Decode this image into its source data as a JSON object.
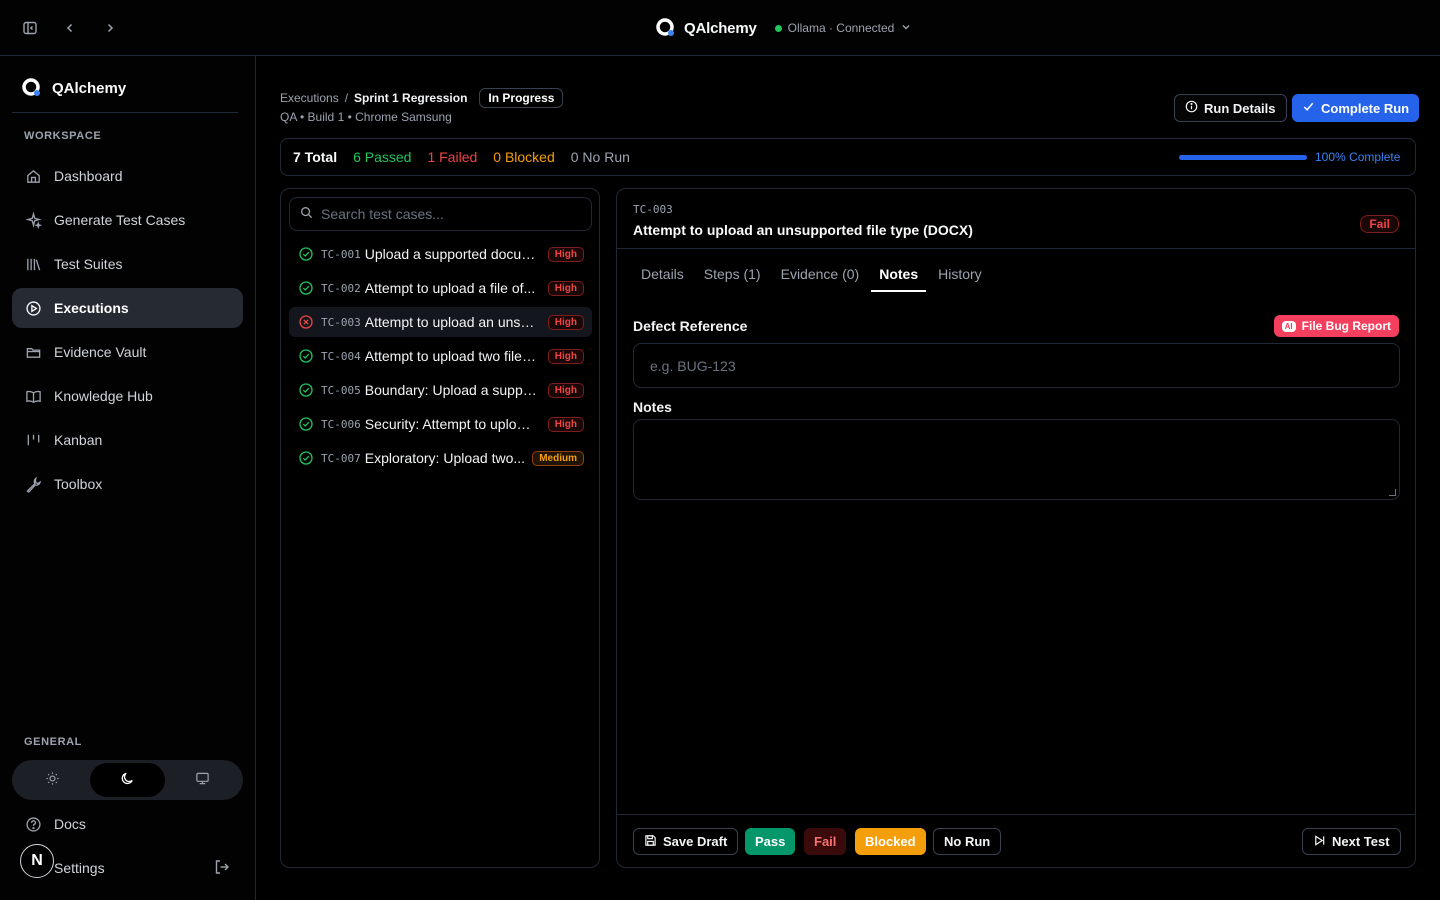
{
  "titlebar": {
    "brand": "QAlchemy",
    "status": "Ollama · Connected",
    "icons": [
      "sidebar-toggle-icon",
      "back-icon",
      "forward-icon",
      "chevron-down-icon"
    ]
  },
  "sidebar": {
    "brand": "QAlchemy",
    "workspace_label": "WORKSPACE",
    "general_label": "GENERAL",
    "items": [
      {
        "label": "Dashboard",
        "icon": "home-icon"
      },
      {
        "label": "Generate Test Cases",
        "icon": "sparkles-icon"
      },
      {
        "label": "Test Suites",
        "icon": "library-icon"
      },
      {
        "label": "Executions",
        "icon": "play-circle-icon",
        "active": true
      },
      {
        "label": "Evidence Vault",
        "icon": "folder-icon"
      },
      {
        "label": "Knowledge Hub",
        "icon": "book-icon"
      },
      {
        "label": "Kanban",
        "icon": "kanban-icon"
      },
      {
        "label": "Toolbox",
        "icon": "wrench-icon"
      }
    ],
    "theme_options": [
      "light",
      "dark",
      "system"
    ],
    "theme_selected": "dark",
    "general_items": [
      {
        "label": "Docs",
        "icon": "help-circle-icon"
      },
      {
        "label": "Settings",
        "icon": "settings-icon"
      }
    ],
    "avatar_letter": "N"
  },
  "header": {
    "breadcrumb_root": "Executions",
    "breadcrumb_sep": "/",
    "breadcrumb_current": "Sprint 1 Regression",
    "status_pill": "In Progress",
    "subline": "QA • Build 1 • Chrome Samsung",
    "run_details_label": "Run Details",
    "complete_run_label": "Complete Run"
  },
  "stats": {
    "total": "7 Total",
    "passed": "6 Passed",
    "failed": "1 Failed",
    "blocked": "0 Blocked",
    "no_run": "0 No Run",
    "progress_fraction": 1.0,
    "progress_label": "100% Complete"
  },
  "test_list": {
    "search_placeholder": "Search test cases...",
    "items": [
      {
        "id": "TC-001",
        "title": "Upload a supported document...",
        "priority": "High",
        "status": "passed"
      },
      {
        "id": "TC-002",
        "title": "Attempt to upload a file of...",
        "priority": "High",
        "status": "passed"
      },
      {
        "id": "TC-003",
        "title": "Attempt to upload an unsupported...",
        "priority": "High",
        "status": "failed",
        "selected": true
      },
      {
        "id": "TC-004",
        "title": "Attempt to upload two files...",
        "priority": "High",
        "status": "passed"
      },
      {
        "id": "TC-005",
        "title": "Boundary: Upload a supported...",
        "priority": "High",
        "status": "passed"
      },
      {
        "id": "TC-006",
        "title": "Security: Attempt to upload...",
        "priority": "High",
        "status": "passed"
      },
      {
        "id": "TC-007",
        "title": "Exploratory: Upload two...",
        "priority": "Medium",
        "status": "passed"
      }
    ]
  },
  "detail": {
    "id": "TC-003",
    "title": "Attempt to upload an unsupported file type (DOCX)",
    "result_badge": "Fail",
    "tabs": [
      "Details",
      "Steps (1)",
      "Evidence (0)",
      "Notes",
      "History"
    ],
    "active_tab": "Notes",
    "defect_label": "Defect Reference",
    "file_bug_label": "File Bug Report",
    "ai_badge": "AI",
    "defect_placeholder": "e.g. BUG-123",
    "notes_label": "Notes",
    "notes_value": "",
    "footer": {
      "save_draft": "Save Draft",
      "pass": "Pass",
      "fail": "Fail",
      "blocked": "Blocked",
      "no_run": "No Run",
      "next_test": "Next Test"
    }
  },
  "colors": {
    "background": "#000000",
    "accent": "#2563eb",
    "pass": "#22c55e",
    "fail": "#ef4444",
    "blocked": "#f59e0b",
    "bug_button": "#f43f5e"
  }
}
